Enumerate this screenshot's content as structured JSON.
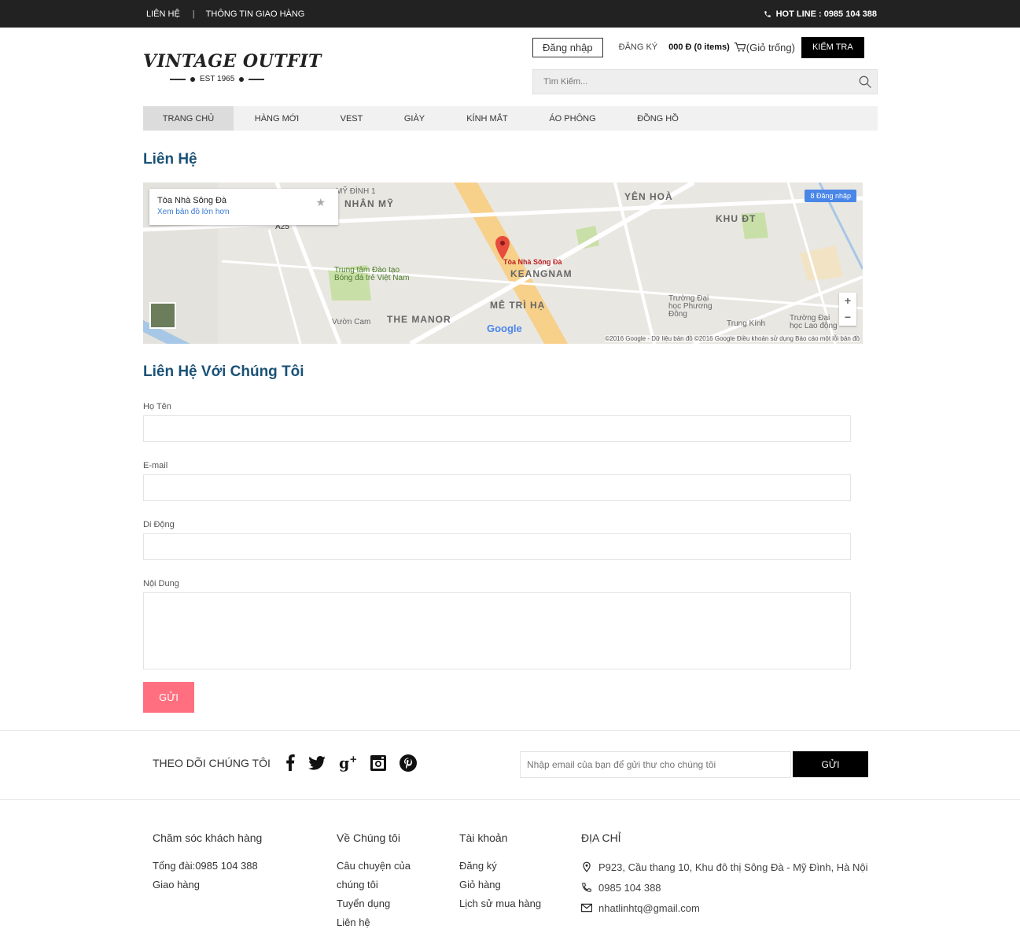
{
  "topbar": {
    "contact": "LIÊN HỆ",
    "shipping": "THÔNG TIN GIAO HÀNG",
    "hotline": "HOT LINE : 0985 104 388"
  },
  "logo": {
    "brand": "VINTAGE OUTFIT",
    "est": "EST 1965"
  },
  "account": {
    "login": "Đăng nhập",
    "register": "ĐĂNG KÝ",
    "cart_total": "000 Đ (0 items)",
    "cart_empty": "(Giỏ trống)",
    "check": "KIỂM TRA"
  },
  "search": {
    "placeholder": "Tìm Kiếm..."
  },
  "nav": [
    {
      "label": "TRANG CHỦ"
    },
    {
      "label": "HÀNG MỚI"
    },
    {
      "label": "VEST"
    },
    {
      "label": "GIÀY"
    },
    {
      "label": "KÍNH MẮT"
    },
    {
      "label": "ÁO PHÔNG"
    },
    {
      "label": "ĐỒNG HỒ"
    }
  ],
  "page": {
    "title": "Liên Hệ",
    "form_title": "Liên Hệ Với Chúng Tôi"
  },
  "map": {
    "place_name": "Tòa Nhà Sông Đà",
    "larger_map": "Xem bản đồ lớn hơn",
    "sign_in": "8 Đăng nhập",
    "pin_label": "Tòa Nhà Sông Đà",
    "footer": "©2016 Google - Dữ liệu bản đồ ©2016 Google   Điều khoản sử dụng   Báo cáo một lỗi bản đồ",
    "google": "Google",
    "labels": {
      "my_dinh": "MỸ ĐÌNH 1",
      "nhan_my": "NHÂN MỸ",
      "yen_hoa": "YÊN HOÀ",
      "khu_dt": "KHU ĐT",
      "keangnam": "KEANGNAM",
      "me_tri_ha": "MỄ TRÌ HẠ",
      "the_manor": "THE MANOR",
      "training": "Trung tâm Đào tạo\nBóng đá trẻ Việt Nam",
      "phuong_dong": "Trường Đại\nhọc Phương\nĐông",
      "lao_dong": "Trường Đại\nhọc Lao động",
      "a25": "A25",
      "vuon_cam": "Vườn Cam",
      "trung_kinh": "Trung Kính"
    }
  },
  "form": {
    "name_label": "Họ Tên",
    "email_label": "E-mail",
    "phone_label": "Di Động",
    "content_label": "Nội Dung",
    "submit": "GỬI"
  },
  "follow": {
    "label": "THEO DÕI CHÚNG TÔI",
    "newsletter_placeholder": "Nhập email của bạn để gửi thư cho chúng tôi",
    "newsletter_button": "GỬI"
  },
  "footer": {
    "customer": {
      "heading": "Chăm sóc khách hàng",
      "items": [
        "Tổng đài:0985 104 388",
        "Giao hàng"
      ]
    },
    "about": {
      "heading": "Về Chúng tôi",
      "items": [
        "Câu chuyện của",
        "chúng tôi",
        "Tuyển dụng",
        "Liên hệ"
      ]
    },
    "account": {
      "heading": "Tài khoản",
      "items": [
        "Đăng ký",
        "Giỏ hàng",
        "Lịch sử mua hàng"
      ]
    },
    "address": {
      "heading": "ĐỊA CHỈ",
      "address": "P923, Cầu thang 10, Khu đô thị Sông Đà - Mỹ Đình, Hà Nội",
      "phone": "0985 104 388",
      "email": "nhatlinhtq@gmail.com"
    }
  },
  "colors": {
    "accent": "#ff6f80",
    "heading": "#1a5276",
    "topbar": "#222222"
  }
}
